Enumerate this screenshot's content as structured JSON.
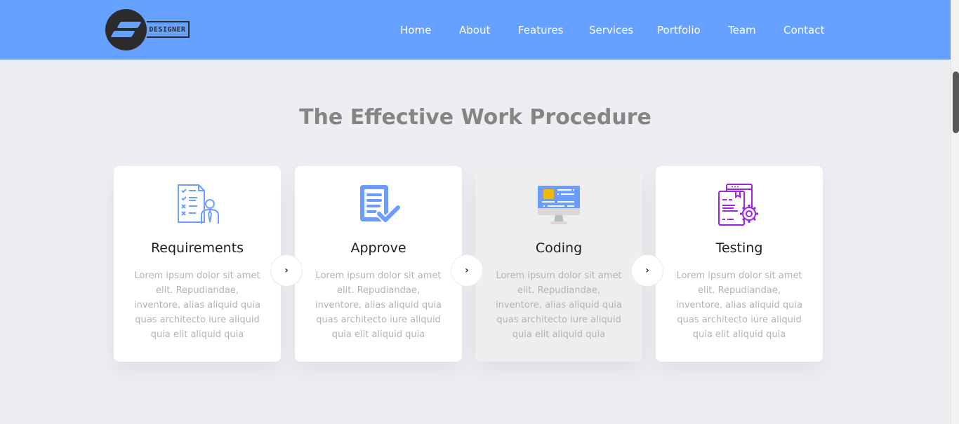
{
  "brand": {
    "logo_text": "DESIGNER",
    "color": "#66a1ff"
  },
  "nav": {
    "items": [
      {
        "label": "Home"
      },
      {
        "label": "About"
      },
      {
        "label": "Features"
      },
      {
        "label": "Services"
      },
      {
        "label": "Portfolio"
      },
      {
        "label": "Team"
      },
      {
        "label": "Contact"
      }
    ]
  },
  "section": {
    "title": "The Effective Work Procedure",
    "cards": [
      {
        "title": "Requirements",
        "icon": "requirements-checklist-icon",
        "text": "Lorem ipsum dolor sit amet elit. Repudiandae, inventore, alias aliquid quia quas architecto iure aliquid quia elit aliquid quia"
      },
      {
        "title": "Approve",
        "icon": "approve-document-check-icon",
        "text": "Lorem ipsum dolor sit amet elit. Repudiandae, inventore, alias aliquid quia quas architecto iure aliquid quia elit aliquid quia"
      },
      {
        "title": "Coding",
        "icon": "coding-monitor-icon",
        "text": "Lorem ipsum dolor sit amet elit. Repudiandae, inventore, alias aliquid quia quas architecto iure aliquid quia elit aliquid quia"
      },
      {
        "title": "Testing",
        "icon": "testing-gear-document-icon",
        "text": "Lorem ipsum dolor sit amet elit. Repudiandae, inventore, alias aliquid quia quas architecto iure aliquid quia elit aliquid quia"
      }
    ],
    "arrow_glyph": "›"
  }
}
